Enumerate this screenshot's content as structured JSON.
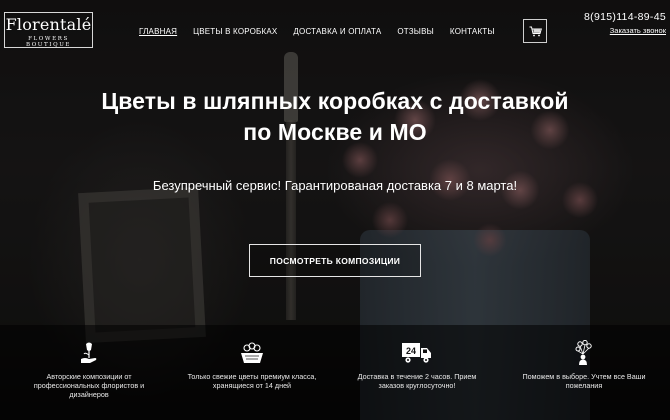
{
  "logo": {
    "name": "Florentalé",
    "tagline": "FLOWERS BOUTIQUE"
  },
  "nav": {
    "items": [
      {
        "label": "ГЛАВНАЯ",
        "active": true
      },
      {
        "label": "ЦВЕТЫ В КОРОБКАХ",
        "active": false
      },
      {
        "label": "ДОСТАВКА И ОПЛАТА",
        "active": false
      },
      {
        "label": "ОТЗЫВЫ",
        "active": false
      },
      {
        "label": "КОНТАКТЫ",
        "active": false
      }
    ]
  },
  "header": {
    "cart_icon": "shopping-cart-icon",
    "phone": "8(915)114-89-45",
    "callback_label": "Заказать звонок"
  },
  "hero": {
    "title_line1": "Цветы в шляпных коробках с доставкой",
    "title_line2": "по Москве и МО",
    "subtitle": "Безупречный сервис! Гарантированая доставка 7 и 8 марта!",
    "cta_label": "ПОСМОТРЕТЬ КОМПОЗИЦИИ"
  },
  "features": [
    {
      "icon": "tulip-hand-icon",
      "line1": "Авторские композиции от",
      "line2": "профессиональных флористов и",
      "line3": "дизайнеров"
    },
    {
      "icon": "flower-basket-icon",
      "line1": "Только свежие цветы премиум класса,",
      "line2": "хранящиеся от 14 дней",
      "line3": ""
    },
    {
      "icon": "delivery-truck-24-icon",
      "line1": "Доставка в течение 2 часов. Прием",
      "line2": "заказов круглосуточно!",
      "line3": ""
    },
    {
      "icon": "bouquet-person-icon",
      "line1": "Поможем в выборе. Учтем все Ваши",
      "line2": "пожелания",
      "line3": ""
    }
  ],
  "colors": {
    "text": "#ffffff",
    "overlay": "#000000",
    "border": "#e6e6e6"
  }
}
